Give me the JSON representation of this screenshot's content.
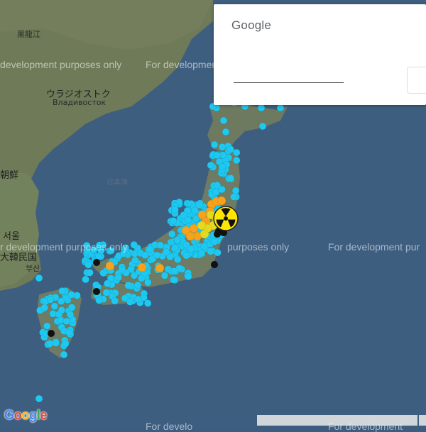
{
  "map": {
    "labels": {
      "heilongjiang": "黒龍江",
      "vladivostok_jp": "ウラジオストク",
      "vladivostok_ru": "Владивосток",
      "korea_north": "朝鮮",
      "sea_of_japan": "日本海",
      "seoul": "서울",
      "south_korea": "大韓民国",
      "busan": "부산"
    },
    "watermark_text": "For development purposes only",
    "watermark_partial_1": "development purposes only",
    "watermark_partial_2": "For development",
    "watermark_partial_3": "r development purposes only",
    "watermark_partial_4": "purposes only",
    "watermark_partial_5": "For development pur",
    "watermark_partial_6": "For develo",
    "watermark_partial_7": "For development",
    "colors": {
      "sea": "#3d5d80",
      "land": "#6f7d62",
      "station_cyan": "#1ec8f0",
      "station_orange": "#f7a21b",
      "station_yellow": "#e5d81e",
      "station_black": "#111111",
      "nuclear_yellow": "#ffe600"
    }
  },
  "dialog": {
    "title": "Google"
  },
  "google_logo": {
    "letters": [
      "G",
      "o",
      "o",
      "g",
      "l",
      "e"
    ]
  }
}
